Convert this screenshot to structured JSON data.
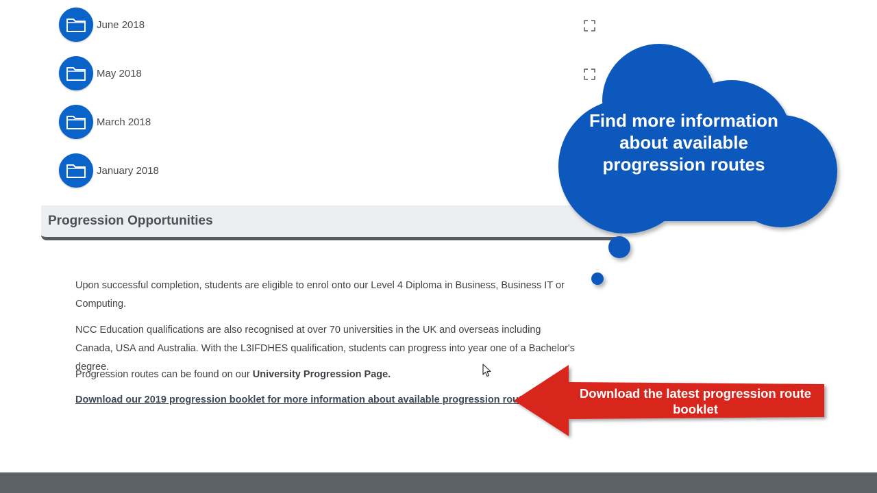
{
  "folders": [
    {
      "label": "June 2018"
    },
    {
      "label": "May 2018"
    },
    {
      "label": "March 2018"
    },
    {
      "label": "January 2018"
    }
  ],
  "section": {
    "title": "Progression Opportunities",
    "para1": "Upon successful completion, students are eligible to enrol onto our Level 4 Diploma in Business, Business IT or Computing.",
    "para2": "NCC Education qualifications are also recognised at over 70 universities in the UK and overseas including Canada, USA and Australia. With the L3IFDHES qualification, students can progress into year one of a Bachelor's degree.",
    "para3_prefix": "Progression routes can be found on our ",
    "para3_link": "University Progression Page.",
    "download_link": "Download our 2019 progression booklet for more information about available progression routes."
  },
  "callouts": {
    "cloud_text": "Find more information about available progression routes",
    "arrow_text": "Download the latest progression route booklet"
  },
  "colors": {
    "folder_blue": "#0a63c9",
    "cloud_blue": "#0a58bc",
    "arrow_red": "#d9251d",
    "footer_gray": "#5c6168"
  }
}
